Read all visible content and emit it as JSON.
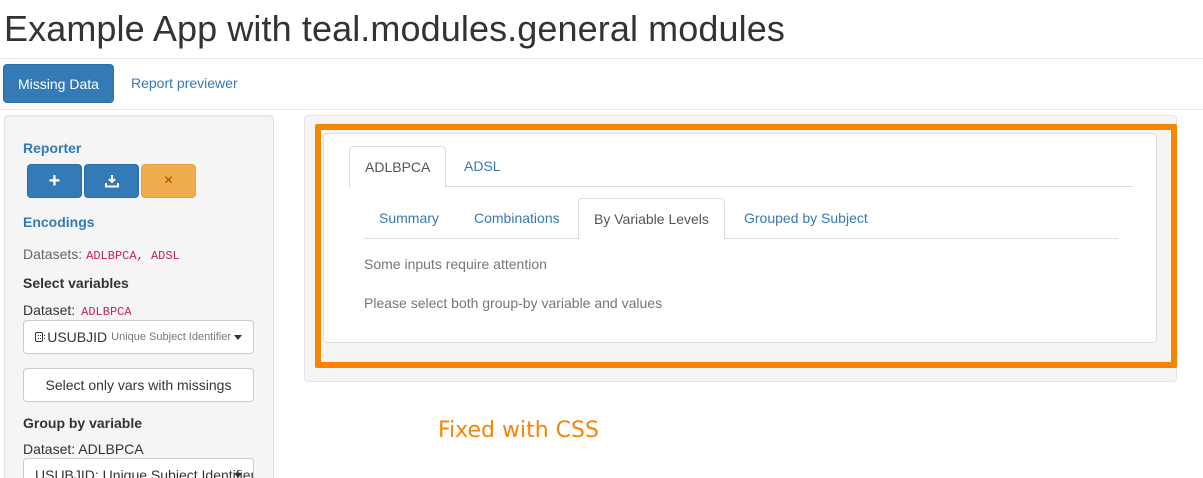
{
  "app": {
    "title": "Example App with teal.modules.general modules"
  },
  "nav": {
    "tabs": [
      {
        "label": "Missing Data",
        "active": true
      },
      {
        "label": "Report previewer",
        "active": false
      }
    ]
  },
  "sidebar": {
    "reporter_heading": "Reporter",
    "reporter_buttons": [
      {
        "icon": "plus-icon",
        "glyph": "+"
      },
      {
        "icon": "download-icon"
      },
      {
        "icon": "close-icon",
        "glyph": "×"
      }
    ],
    "encodings_heading": "Encodings",
    "datasets_label": "Datasets:",
    "datasets_value": "ADLBPCA, ADSL",
    "select_variables_label": "Select variables",
    "dataset_label": "Dataset:",
    "dataset_value": "ADLBPCA",
    "variable_picker": {
      "main": "USUBJID",
      "sub": "Unique Subject Identifier"
    },
    "missings_button": "Select only vars with missings",
    "group_by_label": "Group by variable",
    "group_dataset_text": "Dataset: ADLBPCA",
    "group_picker": "USUBJID: Unique Subject Identifier"
  },
  "main": {
    "dataset_tabs": [
      {
        "label": "ADLBPCA",
        "active": true
      },
      {
        "label": "ADSL",
        "active": false
      }
    ],
    "view_tabs": [
      {
        "label": "Summary",
        "active": false
      },
      {
        "label": "Combinations",
        "active": false
      },
      {
        "label": "By Variable Levels",
        "active": true
      },
      {
        "label": "Grouped by Subject",
        "active": false
      }
    ],
    "message_1": "Some inputs require attention",
    "message_2": "Please select both group-by variable and values"
  },
  "annotation": {
    "text": "Fixed with CSS",
    "color": "#f88400"
  },
  "colors": {
    "primary": "#337ab7",
    "warning": "#f0ad4e",
    "highlight": "#f88400"
  }
}
